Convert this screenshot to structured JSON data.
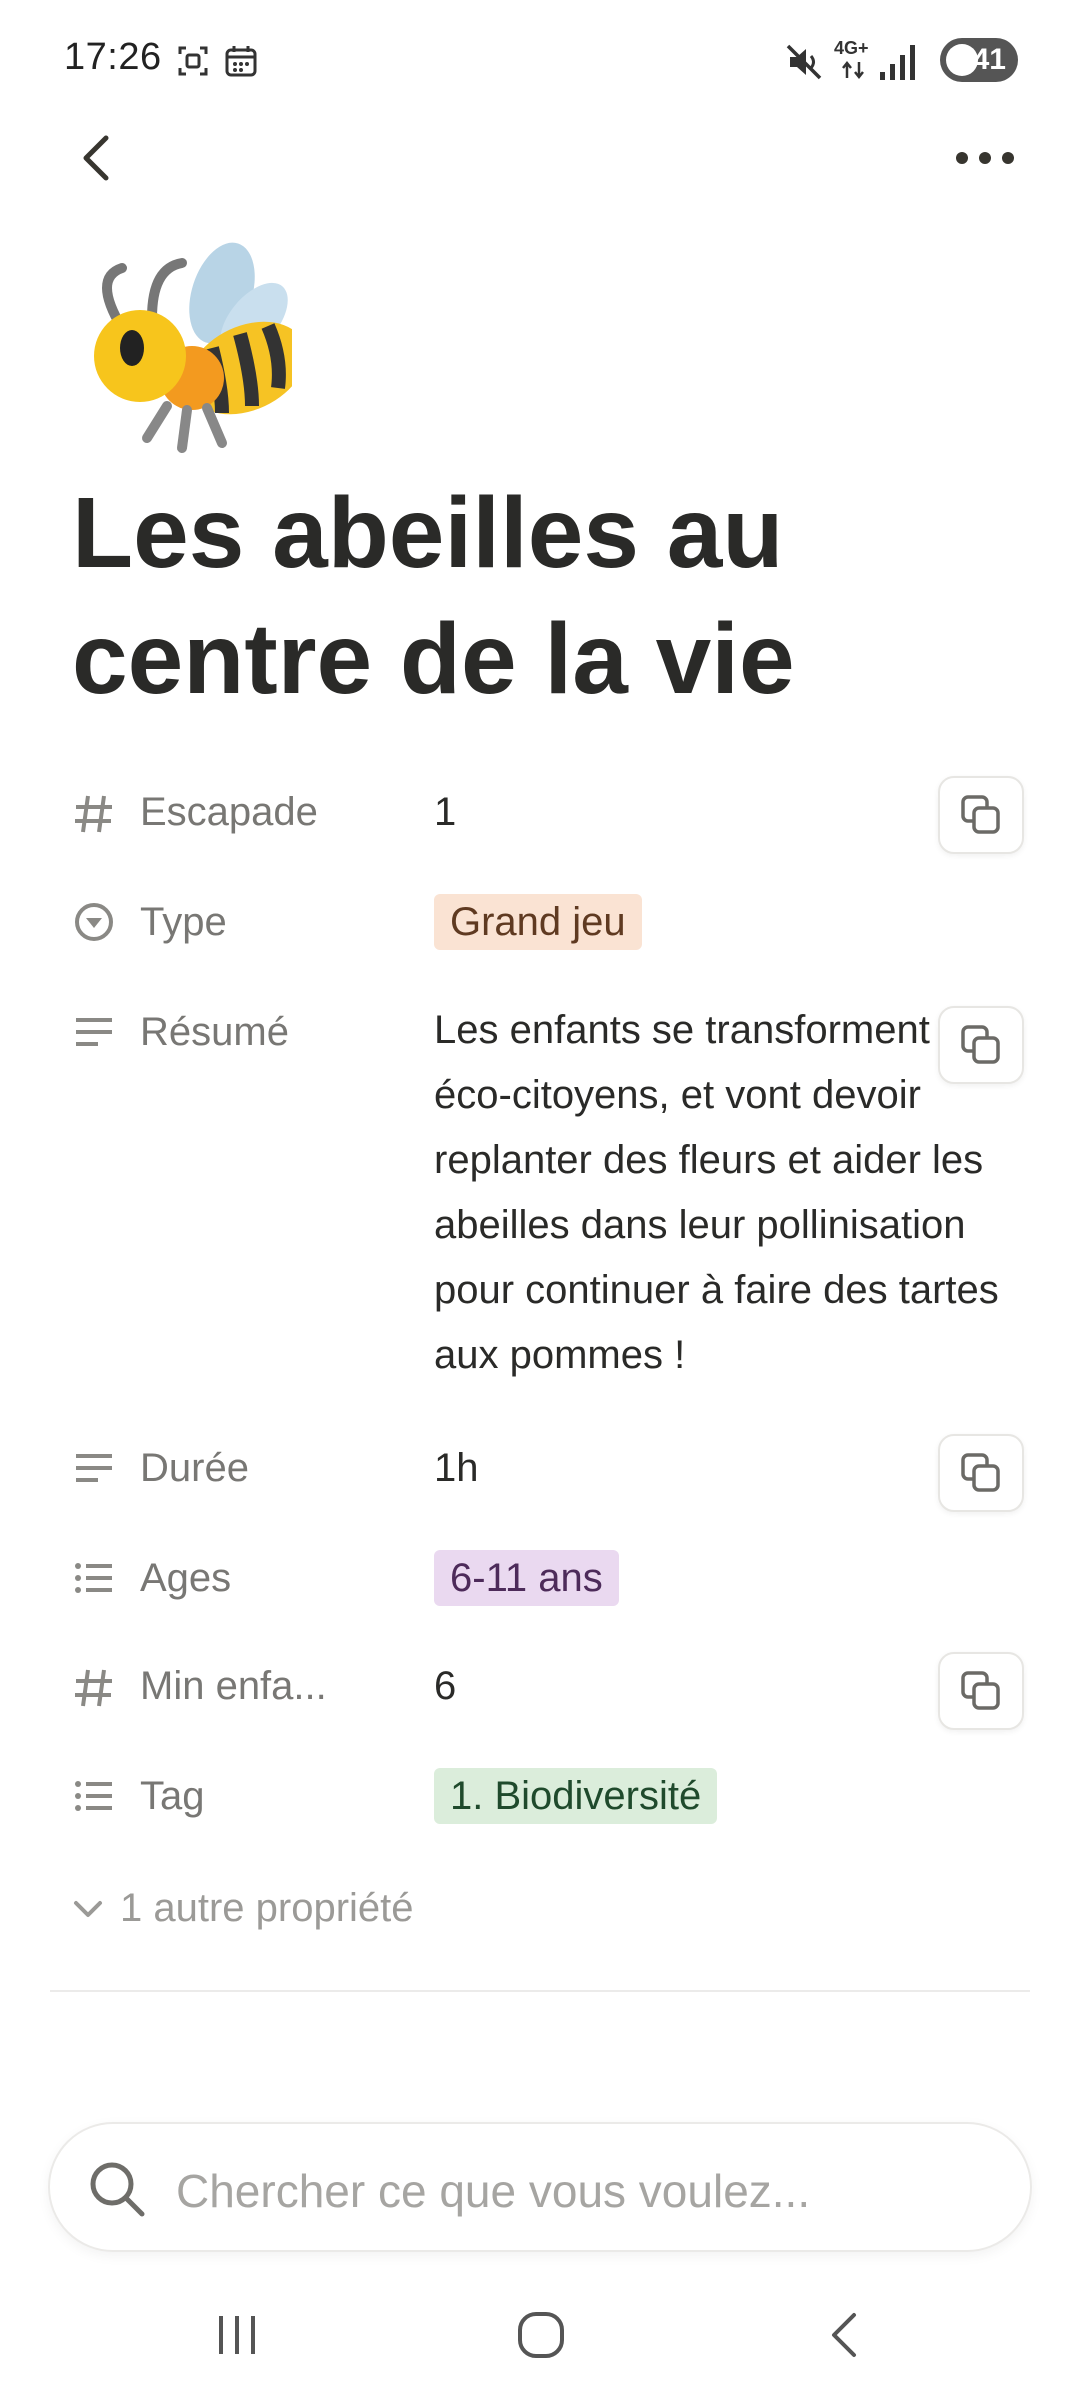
{
  "status_bar": {
    "time": "17:26",
    "network": "4G+",
    "battery": "41",
    "icons": [
      "screenshot-icon",
      "calendar-icon",
      "mute-icon",
      "network-4g-icon",
      "signal-icon",
      "battery-icon"
    ]
  },
  "nav": {
    "back_icon": "chevron-left-icon",
    "more_icon": "more-horizontal-icon"
  },
  "page": {
    "icon": "bee-emoji",
    "title": "Les abeilles au centre de la vie"
  },
  "properties": [
    {
      "icon": "hash-icon",
      "label": "Escapade",
      "value": "1",
      "copyable": true
    },
    {
      "icon": "select-icon",
      "label": "Type",
      "tag": "Grand jeu",
      "tag_color": "#fae3d3"
    },
    {
      "icon": "text-icon",
      "label": "Résumé",
      "value": "Les enfants se transforment en éco-citoyens, et vont devoir replanter des fleurs et aider les abeilles dans leur pollinisation pour continuer à faire des tartes aux pommes !",
      "copyable": true
    },
    {
      "icon": "text-icon",
      "label": "Durée",
      "value": "1h",
      "copyable": true
    },
    {
      "icon": "multi-select-icon",
      "label": "Ages",
      "tag": "6-11 ans",
      "tag_color": "#ead9f0"
    },
    {
      "icon": "hash-icon",
      "label": "Min enfa...",
      "value": "6",
      "copyable": true
    },
    {
      "icon": "multi-select-icon",
      "label": "Tag",
      "tag": "1. Biodiversité",
      "tag_color": "#dbeddb"
    }
  ],
  "more_properties": "1 autre propriété",
  "search": {
    "placeholder": "Chercher ce que vous voulez..."
  },
  "system_nav": [
    "recent-apps-icon",
    "home-icon",
    "back-icon"
  ]
}
